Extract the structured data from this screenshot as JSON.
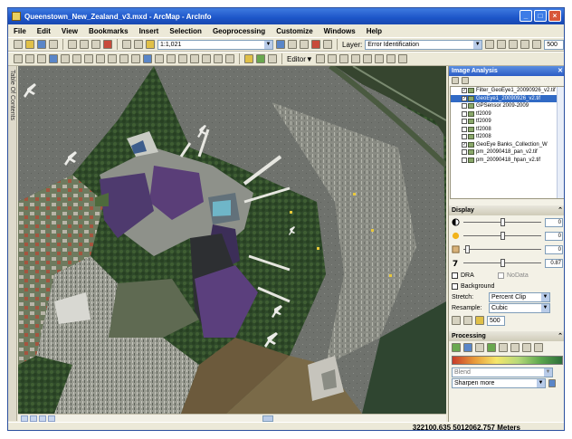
{
  "window": {
    "title": "Queenstown_New_Zealand_v3.mxd - ArcMap - ArcInfo",
    "buttons": [
      "_",
      "□",
      "×"
    ]
  },
  "menu": [
    "File",
    "Edit",
    "View",
    "Bookmarks",
    "Insert",
    "Selection",
    "Geoprocessing",
    "Customize",
    "Windows",
    "Help"
  ],
  "toolbar1": {
    "scale_value": "1:1,021",
    "layer_label": "Layer:",
    "layer_value": "Error Identification",
    "zoom_value": "500"
  },
  "toolbar2": {
    "editor_label": "Editor▼"
  },
  "left_dock_label": "Table Of Contents",
  "image_analysis": {
    "title": "Image Analysis",
    "layers": [
      {
        "name": "Filter_GeoEye1_20090926_v2.tif",
        "checked": true,
        "selected": false
      },
      {
        "name": "GeoEye1_20090926_v2.tif",
        "checked": true,
        "selected": true
      },
      {
        "name": "GPSensor 2009-2009",
        "checked": false,
        "selected": false
      },
      {
        "name": "tf2009",
        "checked": false,
        "selected": false
      },
      {
        "name": "tf2009",
        "checked": false,
        "selected": false
      },
      {
        "name": "tf2008",
        "checked": false,
        "selected": false
      },
      {
        "name": "tf2008",
        "checked": false,
        "selected": false
      },
      {
        "name": "GeoEye Banks_Collection_W",
        "checked": true,
        "selected": false
      },
      {
        "name": "pm_20090418_pan_v2.tif",
        "checked": false,
        "selected": false
      },
      {
        "name": "pm_20090418_hpan_v2.tif",
        "checked": false,
        "selected": false
      }
    ]
  },
  "display": {
    "title": "Display",
    "sliders": [
      {
        "icon": "contrast-icon",
        "value": "0",
        "fraction": 0.5
      },
      {
        "icon": "brightness-icon",
        "value": "0",
        "fraction": 0.5
      },
      {
        "icon": "transparency-icon",
        "value": "0",
        "fraction": 0.05
      },
      {
        "icon": "gamma-icon",
        "value": "0.87",
        "fraction": 0.5
      }
    ],
    "dra_label": "DRA",
    "nodata_label": "NoData",
    "background_label": "Background",
    "stretch_label": "Stretch:",
    "stretch_value": "Percent Clip",
    "resample_label": "Resample:",
    "resample_value": "Cubic",
    "bottom_value": "500"
  },
  "processing": {
    "title": "Processing",
    "blend_value": "Blend",
    "function_value": "Sharpen more"
  },
  "status": {
    "coords": "322100.635  5012062.757 Meters"
  }
}
